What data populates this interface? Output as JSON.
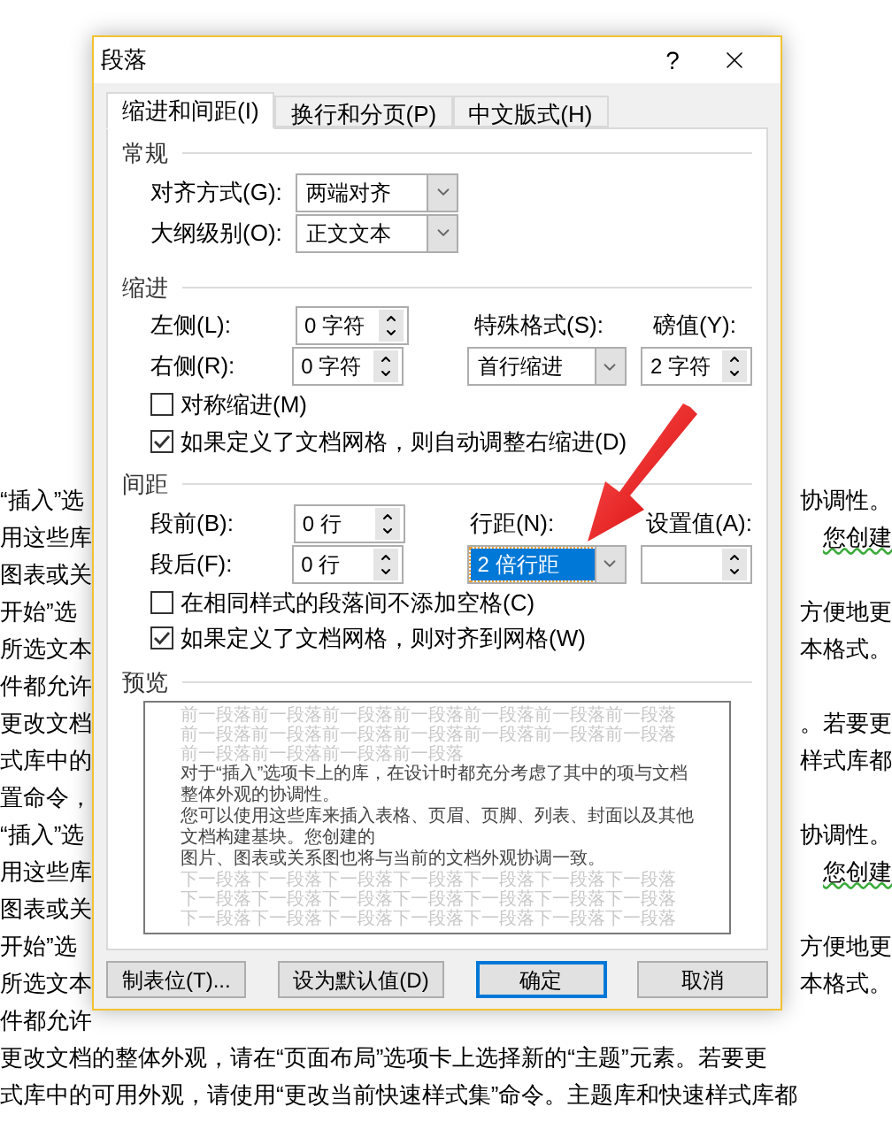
{
  "document": {
    "lines": [
      {
        "left": "“插入”选",
        "right": "协调性。",
        "right_flagged": false
      },
      {
        "left": "用这些库",
        "right": "您创建",
        "right_flagged": true
      },
      {
        "left": "图表或关"
      },
      {
        "left": "开始”选",
        "right": "方便地更",
        "right_flagged": false
      },
      {
        "left": "所选文本",
        "right": "本格式。",
        "right_flagged": false
      },
      {
        "left": "件都允许"
      },
      {
        "left": "更改文档",
        "right": "。若要更",
        "right_flagged": false
      },
      {
        "left": "式库中的",
        "right": "样式库都",
        "right_flagged": false
      },
      {
        "left": "置命令，"
      },
      {
        "left": "“插入”选",
        "right": "协调性。",
        "right_flagged": false
      },
      {
        "left": "用这些库",
        "right": "您创建",
        "right_flagged": true
      },
      {
        "left": "图表或关"
      },
      {
        "left": "开始”选",
        "right": "方便地更",
        "right_flagged": false
      },
      {
        "left": "所选文本",
        "right": "本格式。",
        "right_flagged": false
      },
      {
        "left": "件都允许"
      },
      {
        "left": "更改文档的整体外观，请在“页面布局”选项卡上选择新的“主题”元素。若要更"
      },
      {
        "left": "式库中的可用外观，请使用“更改当前快速样式集”命令。主题库和快速样式库都"
      }
    ]
  },
  "dialog": {
    "title": "段落",
    "help": "?",
    "tabs": [
      {
        "label": "缩进和间距(I)",
        "selected": true
      },
      {
        "label": "换行和分页(P)",
        "selected": false
      },
      {
        "label": "中文版式(H)",
        "selected": false
      }
    ],
    "general": {
      "heading": "常规",
      "alignment": {
        "label": "对齐方式(G):",
        "value": "两端对齐"
      },
      "outline": {
        "label": "大纲级别(O):",
        "value": "正文文本"
      }
    },
    "indent": {
      "heading": "缩进",
      "left": {
        "label": "左侧(L):",
        "value": "0 字符"
      },
      "right": {
        "label": "右侧(R):",
        "value": "0 字符"
      },
      "special": {
        "label": "特殊格式(S):",
        "value": "首行缩进"
      },
      "by": {
        "label": "磅值(Y):",
        "value": "2 字符"
      },
      "checkboxes": [
        {
          "label": "对称缩进(M)",
          "checked": false
        },
        {
          "label": "如果定义了文档网格，则自动调整右缩进(D)",
          "checked": true
        }
      ]
    },
    "spacing": {
      "heading": "间距",
      "before": {
        "label": "段前(B):",
        "value": "0 行"
      },
      "after": {
        "label": "段后(F):",
        "value": "0 行"
      },
      "line_spacing": {
        "label": "行距(N):",
        "value": "2 倍行距",
        "highlighted": true
      },
      "at": {
        "label": "设置值(A):"
      },
      "checkboxes": [
        {
          "label": "在相同样式的段落间不添加空格(C)",
          "checked": false
        },
        {
          "label": "如果定义了文档网格，则对齐到网格(W)",
          "checked": true
        }
      ]
    },
    "preview": {
      "heading": "预览",
      "before_lines": [
        "前一段落前一段落前一段落前一段落前一段落前一段落前一段落",
        "前一段落前一段落前一段落前一段落前一段落前一段落前一段落",
        "前一段落前一段落前一段落前一段落"
      ],
      "body_lines": [
        "对于“插入”选项卡上的库，在设计时都充分考虑了其中的项与文档整体外观的协调性。",
        "您可以使用这些库来插入表格、页眉、页脚、列表、封面以及其他文档构建基块。您创建的",
        "图片、图表或关系图也将与当前的文档外观协调一致。"
      ],
      "after_lines": [
        "下一段落下一段落下一段落下一段落下一段落下一段落下一段落",
        "下一段落下一段落下一段落下一段落下一段落下一段落下一段落",
        "下一段落下一段落下一段落下一段落下一段落下一段落下一段落"
      ]
    },
    "buttons": [
      {
        "label": "制表位(T)...",
        "default": false
      },
      {
        "label": "设为默认值(D)",
        "default": false
      },
      {
        "label": "确定",
        "default": true
      },
      {
        "label": "取消",
        "default": false
      }
    ]
  }
}
